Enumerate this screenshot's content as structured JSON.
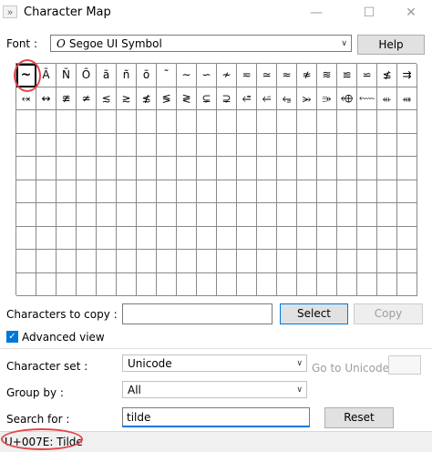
{
  "window": {
    "title": "Character Map",
    "icon_glyph": "»",
    "minimize_glyph": "—",
    "maximize_glyph": "☐",
    "close_glyph": "✕"
  },
  "font": {
    "label": "Font :",
    "selected": "Segoe UI Symbol",
    "icon_glyph": "O",
    "dropdown_glyph": "∨"
  },
  "help_label": "Help",
  "characters": [
    "~",
    "Ã",
    "Ñ",
    "Õ",
    "ã",
    "ñ",
    "õ",
    "˜",
    "∼",
    "∽",
    "≁",
    "≂",
    "≃",
    "≈",
    "≉",
    "≋",
    "≌",
    "⋍",
    "≰",
    "⇉",
    "⬾",
    "↭",
    "≇",
    "≄",
    "≲",
    "≳",
    "≴",
    "≶",
    "≷",
    "⊊",
    "⊋",
    "⭀",
    "⭁",
    "⭂",
    "⭃",
    "⭄",
    "⬲",
    "⬳",
    "⬴",
    "⬵",
    "",
    "",
    "",
    "",
    "",
    "",
    "",
    "",
    "",
    "",
    "",
    "",
    "",
    "",
    "",
    "",
    "",
    "",
    "",
    "",
    "",
    "",
    "",
    "",
    "",
    "",
    "",
    "",
    "",
    "",
    "",
    "",
    "",
    "",
    "",
    "",
    "",
    "",
    "",
    "",
    "",
    "",
    "",
    "",
    "",
    "",
    "",
    "",
    "",
    "",
    "",
    "",
    "",
    "",
    "",
    "",
    "",
    "",
    "",
    "",
    "",
    "",
    "",
    "",
    "",
    "",
    "",
    "",
    "",
    "",
    "",
    "",
    "",
    "",
    "",
    "",
    "",
    "",
    "",
    "",
    "",
    "",
    "",
    "",
    "",
    "",
    "",
    "",
    "",
    "",
    "",
    "",
    "",
    "",
    "",
    "",
    "",
    "",
    "",
    "",
    "",
    "",
    "",
    "",
    "",
    "",
    "",
    "",
    "",
    "",
    "",
    "",
    "",
    "",
    "",
    "",
    "",
    "",
    "",
    "",
    "",
    "",
    "",
    "",
    "",
    "",
    "",
    "",
    "",
    "",
    "",
    "",
    "",
    "",
    "",
    "",
    "",
    "",
    "",
    "",
    "",
    "",
    "",
    "",
    "",
    "",
    "",
    "",
    "",
    "",
    "",
    "",
    "",
    "",
    "",
    "",
    "",
    "",
    "",
    ""
  ],
  "copy": {
    "label": "Characters to copy :",
    "value": "",
    "select_label": "Select",
    "copy_label": "Copy"
  },
  "advanced": {
    "label": "Advanced view",
    "checked": true,
    "check_glyph": "✓"
  },
  "character_set": {
    "label": "Character set :",
    "value": "Unicode",
    "goto_label": "Go to Unicode :",
    "goto_value": ""
  },
  "group_by": {
    "label": "Group by :",
    "value": "All"
  },
  "search": {
    "label": "Search for :",
    "value": "tilde",
    "reset_label": "Reset"
  },
  "status": {
    "text": "U+007E: Tilde"
  },
  "colors": {
    "accent": "#0078d7",
    "annotation": "#e0474c"
  }
}
